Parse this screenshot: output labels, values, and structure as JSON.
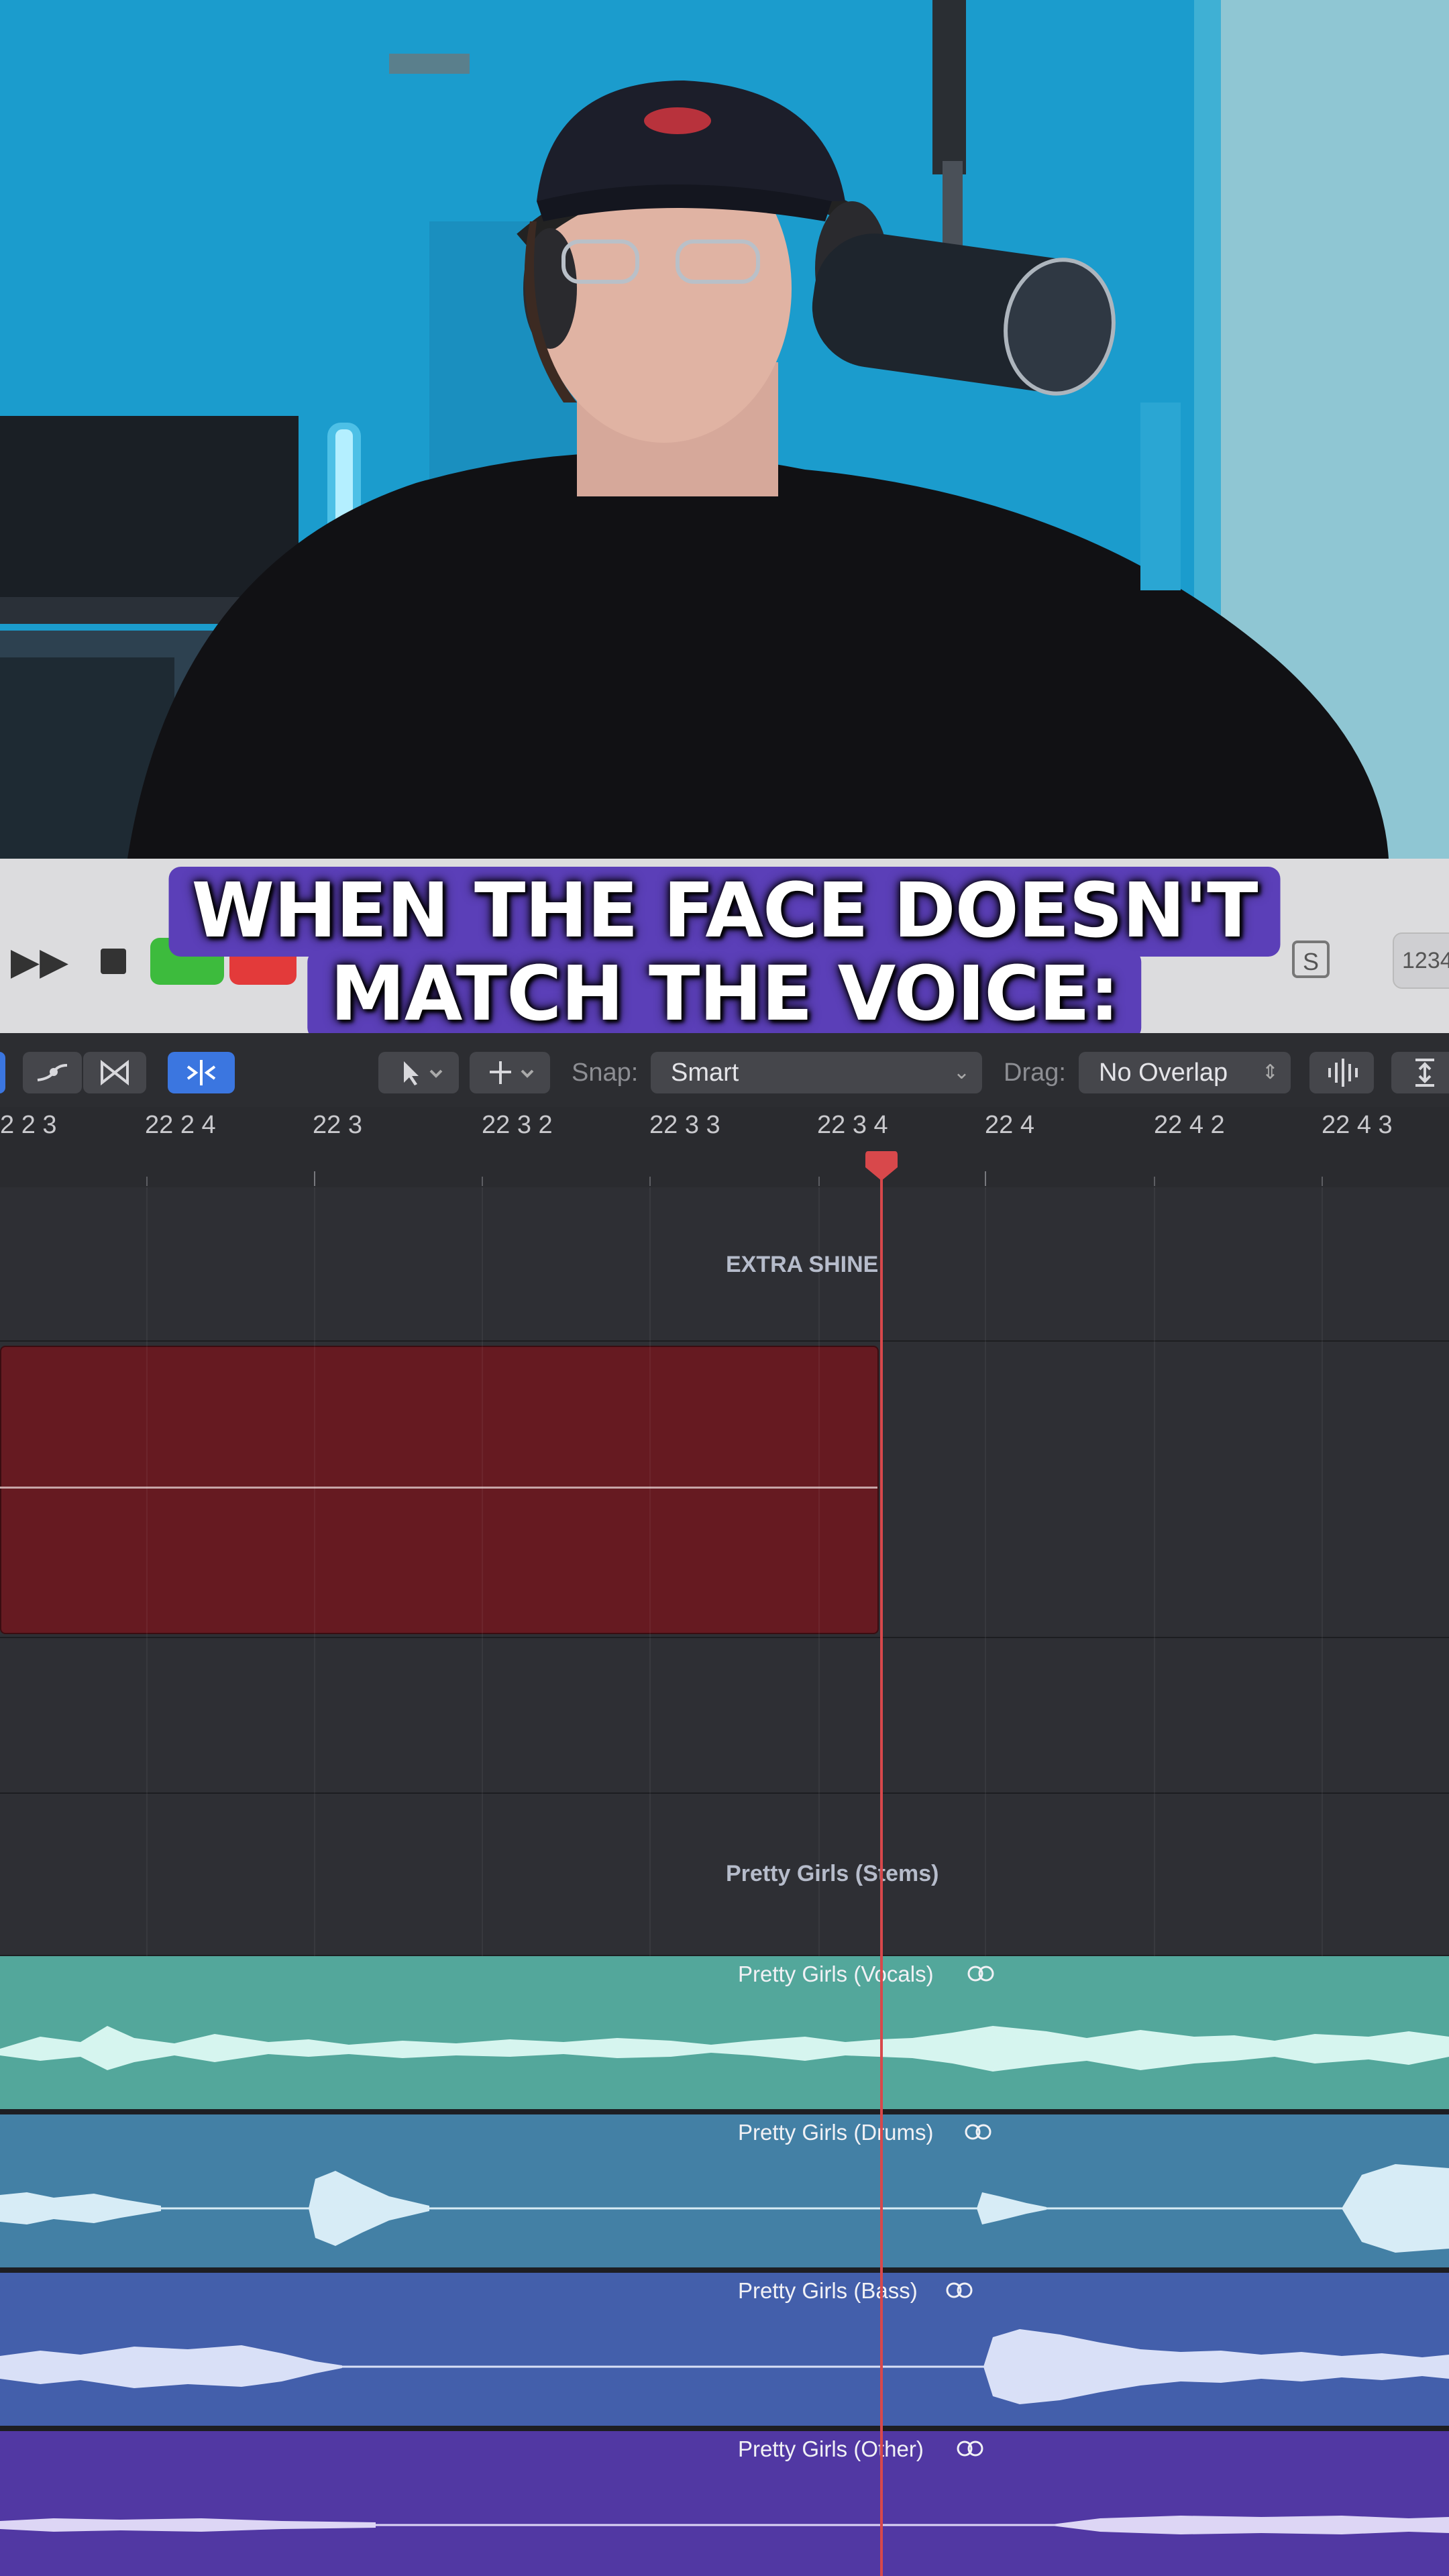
{
  "caption": {
    "line1": "WHEN THE FACE DOESN'T",
    "line2": "MATCH THE VOICE:"
  },
  "transport": {
    "fast_forward_icon": "▶▶",
    "solo_icon": "S",
    "lcd_text": "1234"
  },
  "toolbar": {
    "snap_label": "Snap:",
    "snap_value": "Smart",
    "drag_label": "Drag:",
    "drag_value": "No Overlap",
    "chevron": "⌃⌄"
  },
  "ruler": {
    "labels": [
      "2 2 3",
      "22 2 4",
      "22 3",
      "22 3 2",
      "22 3 3",
      "22 3 4",
      "22 4",
      "22 4 2",
      "22 4 3"
    ]
  },
  "tracks": {
    "extra_shine": "EXTRA SHINE",
    "stems_folder": "Pretty Girls (Stems)",
    "vocals": "Pretty Girls (Vocals)",
    "drums": "Pretty Girls (Drums)",
    "bass": "Pretty Girls (Bass)",
    "other": "Pretty Girls (Other)"
  },
  "colors": {
    "vocals": "#53a79b",
    "drums": "#4380a5",
    "bass": "#435fab",
    "other": "#5138a3",
    "audio_region": "#661a21",
    "playhead": "#d8484b",
    "caption_bg": "#5b3fb8"
  },
  "icons": {
    "loop": "loop-icon",
    "playhead": "playhead-icon"
  }
}
